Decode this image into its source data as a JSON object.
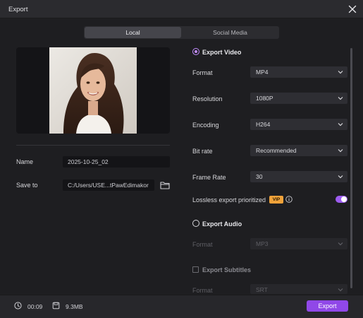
{
  "window": {
    "title": "Export"
  },
  "tabs": [
    {
      "label": "Local",
      "active": true
    },
    {
      "label": "Social Media",
      "active": false
    }
  ],
  "left": {
    "name": {
      "label": "Name",
      "value": "2025-10-25_02"
    },
    "save_to": {
      "label": "Save to",
      "value": "C:/Users/USE...tPawEdimakor"
    }
  },
  "export_video": {
    "label": "Export Video",
    "selected": true,
    "format": {
      "label": "Format",
      "value": "MP4"
    },
    "resolution": {
      "label": "Resolution",
      "value": "1080P"
    },
    "encoding": {
      "label": "Encoding",
      "value": "H264"
    },
    "bit_rate": {
      "label": "Bit rate",
      "value": "Recommended"
    },
    "frame_rate": {
      "label": "Frame Rate",
      "value": "30"
    },
    "lossless": {
      "label": "Lossless export prioritized",
      "badge": "VIP",
      "enabled": true
    }
  },
  "export_audio": {
    "label": "Export Audio",
    "selected": false,
    "format_label": "Format",
    "format_value": "MP3"
  },
  "export_subtitles": {
    "label": "Export Subtitles",
    "checked": false,
    "format_label": "Format",
    "format_value": "SRT"
  },
  "footer": {
    "duration": "00:09",
    "size": "9.3MB",
    "export_label": "Export"
  },
  "colors": {
    "accent": "#9048e8",
    "radio_accent": "#c38dff",
    "vip_badge": "#f0a23a",
    "background": "#1e1e21",
    "titlebar": "#2b2b2f"
  }
}
